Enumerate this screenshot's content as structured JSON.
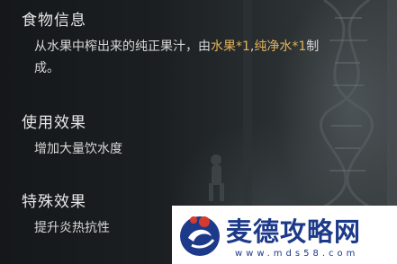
{
  "food_info": {
    "title": "食物信息",
    "desc_part1": "从水果中榨出来的纯正果汁，由",
    "ingredient1": "水果*1",
    "separator": ",",
    "ingredient2": "纯净水*1",
    "desc_part2": "制",
    "desc_line2": "成。"
  },
  "use_effect": {
    "title": "使用效果",
    "text": "增加大量饮水度"
  },
  "special_effect": {
    "title": "特殊效果",
    "text": "提升炎热抗性"
  },
  "watermark": {
    "title": "麦德攻略网",
    "url": "www.mds58.com"
  },
  "colors": {
    "highlight": "#e2b25a",
    "text": "#d8d8d8",
    "watermark_blue": "#1d3a8a"
  }
}
